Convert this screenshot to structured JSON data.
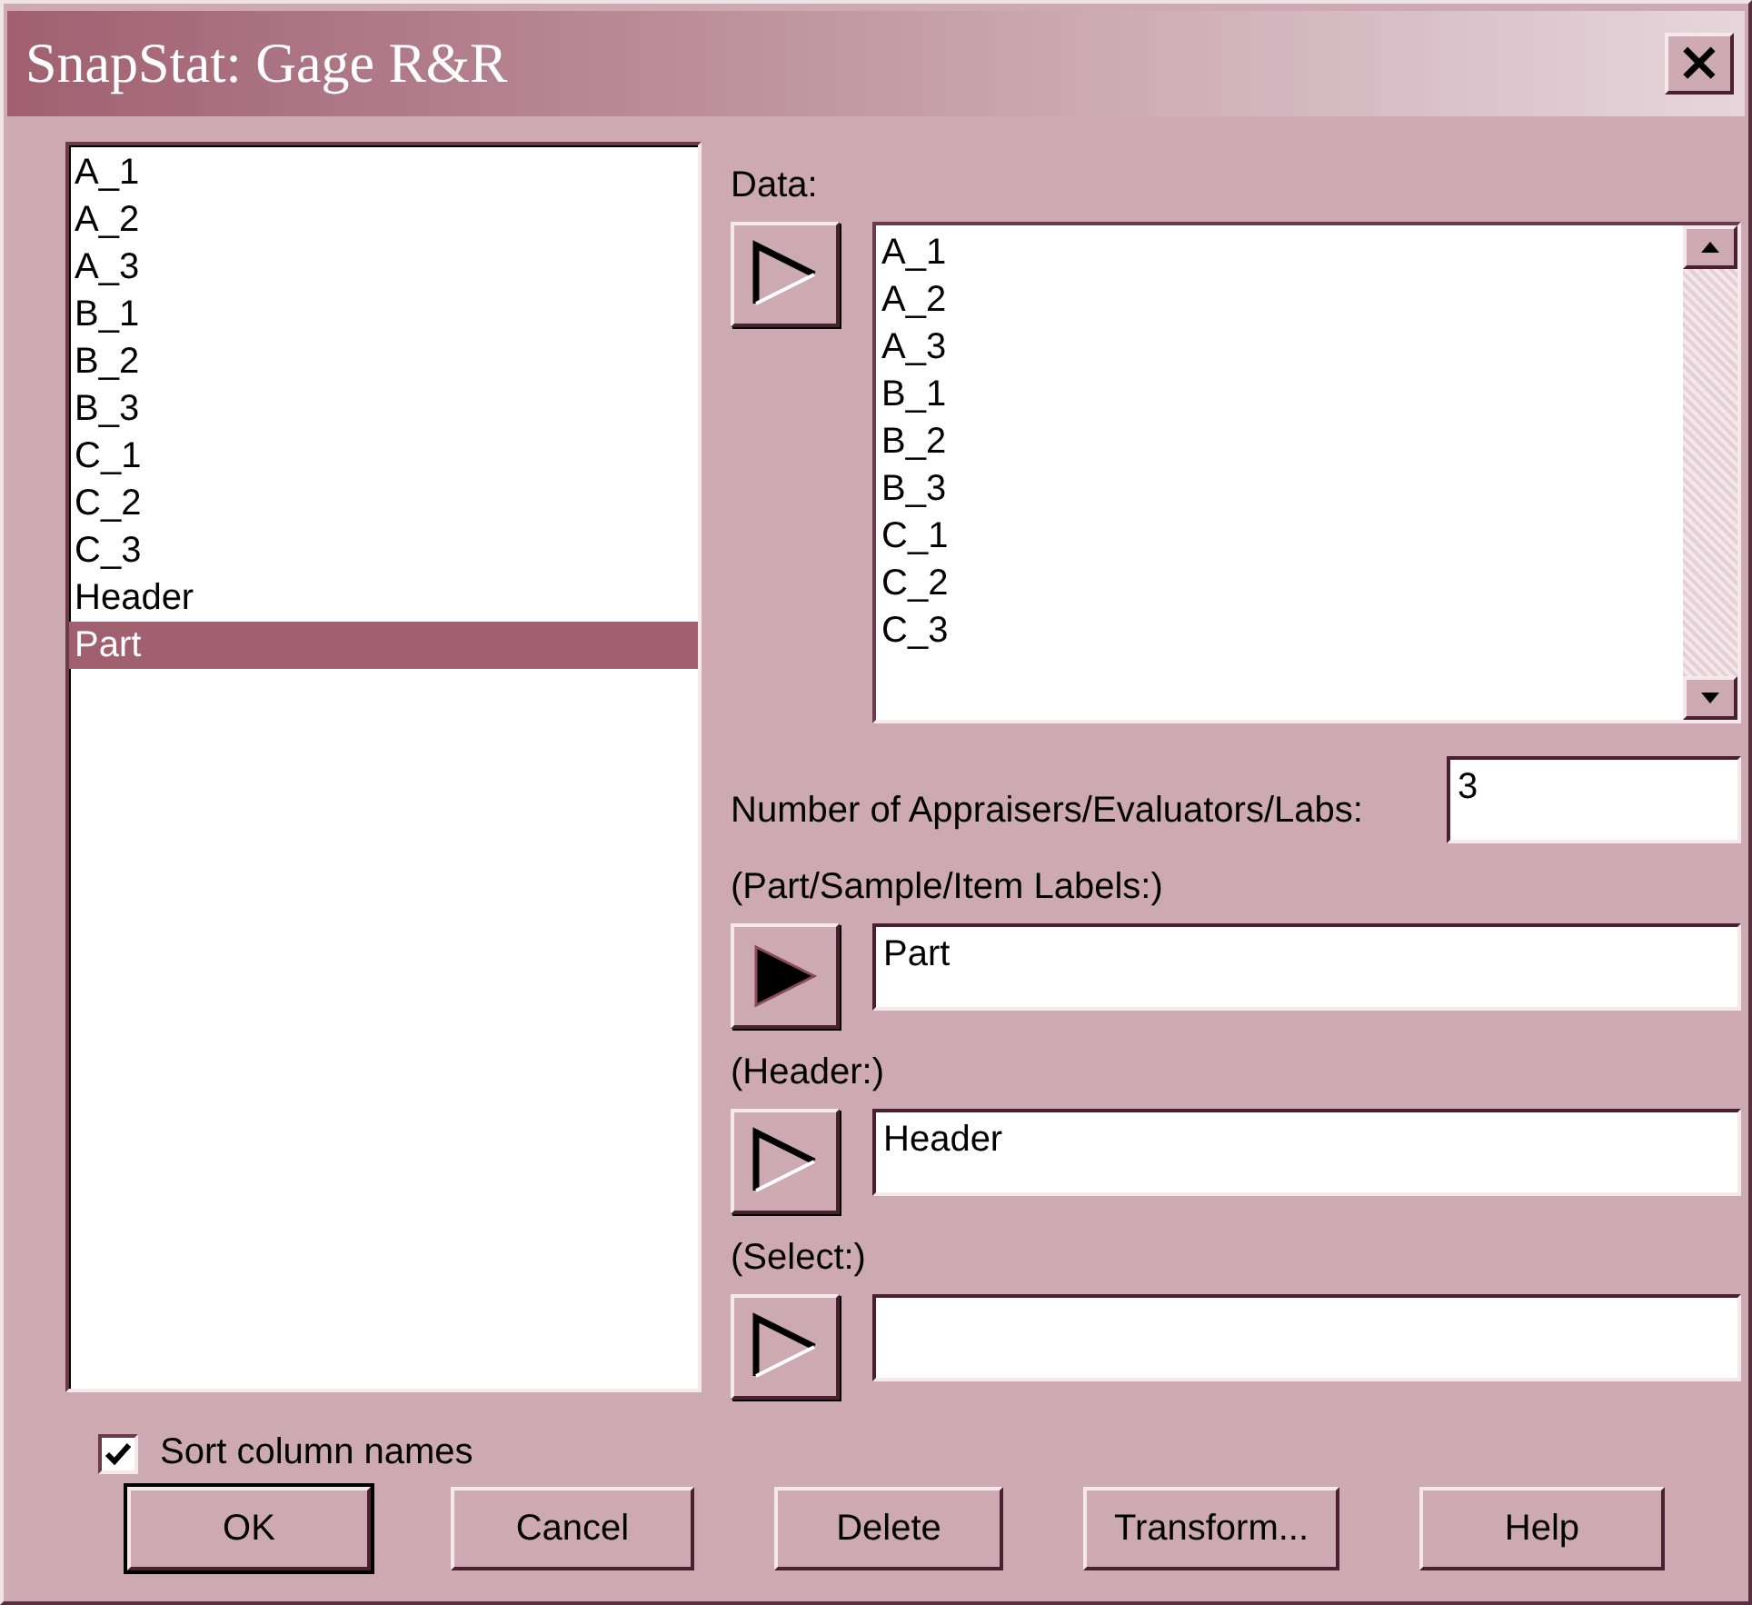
{
  "window": {
    "title": "SnapStat: Gage R&R",
    "close": "×"
  },
  "columns": [
    {
      "name": "A_1",
      "selected": false
    },
    {
      "name": "A_2",
      "selected": false
    },
    {
      "name": "A_3",
      "selected": false
    },
    {
      "name": "B_1",
      "selected": false
    },
    {
      "name": "B_2",
      "selected": false
    },
    {
      "name": "B_3",
      "selected": false
    },
    {
      "name": "C_1",
      "selected": false
    },
    {
      "name": "C_2",
      "selected": false
    },
    {
      "name": "C_3",
      "selected": false
    },
    {
      "name": "Header",
      "selected": false
    },
    {
      "name": "Part",
      "selected": true
    }
  ],
  "data": {
    "label": "Data:",
    "active": false,
    "items": [
      "A_1",
      "A_2",
      "A_3",
      "B_1",
      "B_2",
      "B_3",
      "C_1",
      "C_2",
      "C_3"
    ]
  },
  "appraisers": {
    "label": "Number of Appraisers/Evaluators/Labs:",
    "value": "3"
  },
  "fields": [
    {
      "label": "(Part/Sample/Item Labels:)",
      "value": "Part",
      "active": true
    },
    {
      "label": "(Header:)",
      "value": "Header",
      "active": false
    },
    {
      "label": "(Select:)",
      "active": false
    }
  ],
  "sort": {
    "label": "Sort column names",
    "checked": true
  },
  "buttons": [
    {
      "label": "OK",
      "default": true
    },
    {
      "label": "Cancel",
      "default": false
    },
    {
      "label": "Delete",
      "default": false
    },
    {
      "label": "Transform...",
      "default": false
    },
    {
      "label": "Help",
      "default": false
    }
  ]
}
